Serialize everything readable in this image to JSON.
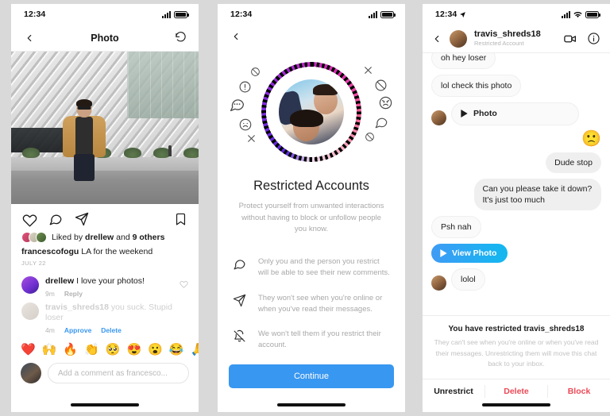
{
  "background_color": "#d9d9d9",
  "accent_blue": "#3897f0",
  "danger_red": "#ed4956",
  "phone1": {
    "status": {
      "time": "12:34"
    },
    "nav": {
      "back_icon": "chevron-left-icon",
      "title": "Photo",
      "refresh_icon": "rotate-back-icon"
    },
    "actions": {
      "like_icon": "heart-icon",
      "comment_icon": "comment-bubble-icon",
      "share_icon": "paper-plane-icon",
      "save_icon": "bookmark-icon"
    },
    "liked_by": {
      "prefix": "Liked by",
      "user": "drellew",
      "middle": "and",
      "others": "9 others"
    },
    "caption": {
      "username": "francescofogu",
      "text": "LA for the weekend"
    },
    "date": "JULY 22",
    "comments": [
      {
        "username": "drellew",
        "text": "I love your photos!",
        "time": "9m",
        "reply_label": "Reply",
        "muted": false,
        "like_icon": "heart-icon"
      },
      {
        "username": "travis_shreds18",
        "text": "you suck. Stupid loser",
        "time": "4m",
        "approve_label": "Approve",
        "delete_label": "Delete",
        "muted": true
      }
    ],
    "emoji_row": [
      "❤️",
      "🙌",
      "🔥",
      "👏",
      "🥺",
      "😍",
      "😮",
      "😂",
      "🙏"
    ],
    "composer": {
      "placeholder": "Add a comment as francesco..."
    }
  },
  "phone2": {
    "status": {
      "time": "12:34"
    },
    "nav": {
      "back_icon": "chevron-left-icon"
    },
    "hero": {
      "avatar_name": "restricted-profile-avatar",
      "surrounding_icons": [
        "block-circle-slash-icon",
        "exclamation-circle-icon",
        "dots-bubble-icon",
        "sad-face-icon",
        "x-mark-icon",
        "x-mark-icon",
        "block-circle-slash-icon",
        "angry-face-icon",
        "comment-bubble-icon",
        "block-circle-slash-icon"
      ]
    },
    "title": "Restricted Accounts",
    "subtitle": "Protect yourself from unwanted interactions without having to block or unfollow people you know.",
    "bullets": [
      {
        "icon": "comment-bubble-icon",
        "text": "Only you and the person you restrict will be able to see their new comments."
      },
      {
        "icon": "paper-plane-icon",
        "text": "They won't see when you're online or when you've read their messages."
      },
      {
        "icon": "bell-slash-icon",
        "text": "We won't tell them if you restrict their account."
      }
    ],
    "cta_label": "Continue"
  },
  "phone3": {
    "status": {
      "time": "12:34",
      "location_icon": "location-arrow-icon",
      "wifi_icon": "wifi-icon"
    },
    "nav": {
      "back_icon": "chevron-left-icon",
      "name": "travis_shreds18",
      "subtitle": "Restricted Account",
      "video_icon": "video-camera-icon",
      "info_icon": "info-circle-icon"
    },
    "messages": [
      {
        "side": "in",
        "type": "text",
        "text": "oh hey loser",
        "clipped": true
      },
      {
        "side": "in",
        "type": "text",
        "text": "lol check this photo"
      },
      {
        "side": "in",
        "type": "photo",
        "label": "Photo",
        "icon": "play-icon",
        "avatar": true
      },
      {
        "side": "out",
        "type": "emoji",
        "text": "🙁"
      },
      {
        "side": "out",
        "type": "text",
        "text": "Dude stop"
      },
      {
        "side": "out",
        "type": "text",
        "text": "Can you please take it down? It's just too much"
      },
      {
        "side": "in",
        "type": "text",
        "text": "Psh nah"
      },
      {
        "side": "in",
        "type": "viewphoto",
        "label": "View Photo",
        "icon": "play-icon"
      },
      {
        "side": "in",
        "type": "text",
        "text": "lolol",
        "avatar": true
      }
    ],
    "notice": {
      "title": "You have restricted travis_shreds18",
      "description": "They can't see when you're online or when you've read their messages. Unrestricting them will move this chat back to your inbox."
    },
    "action_bar": {
      "unrestrict": "Unrestrict",
      "delete": "Delete",
      "block": "Block"
    }
  }
}
